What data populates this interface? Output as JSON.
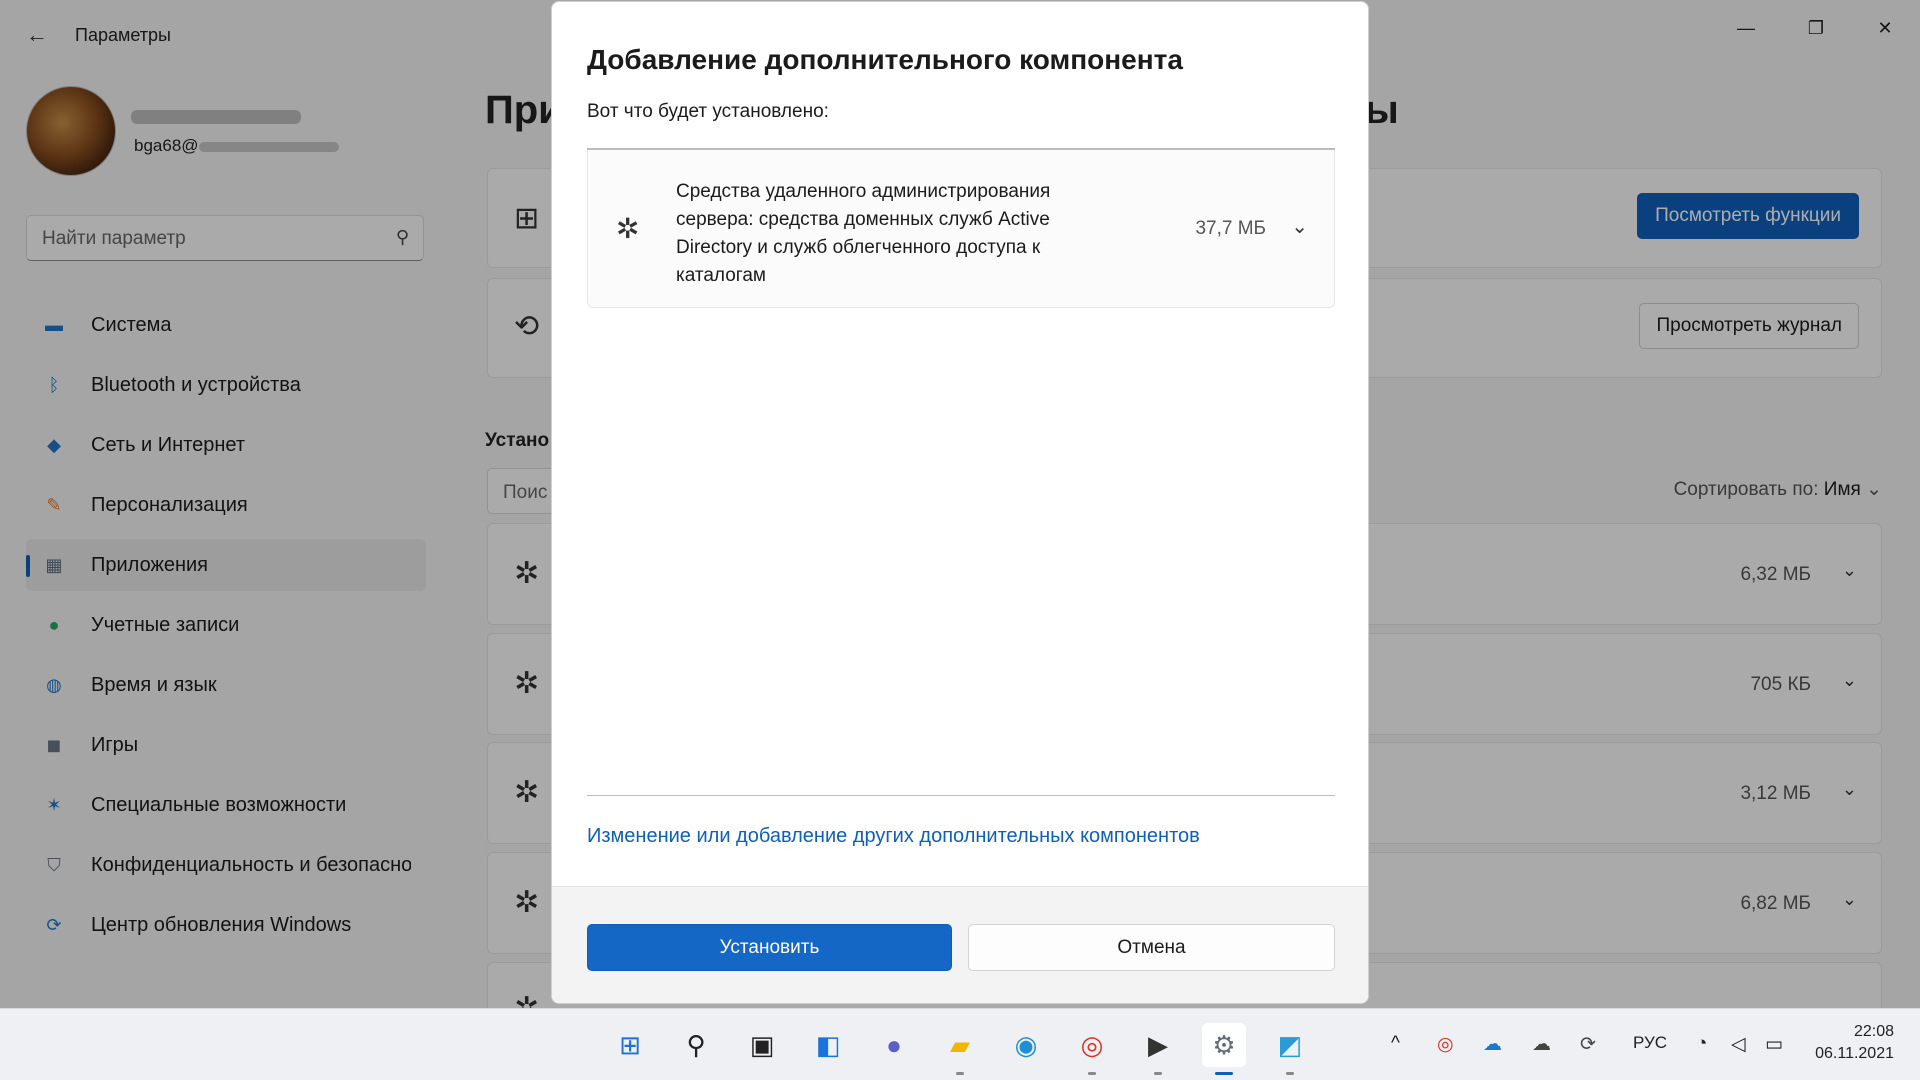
{
  "window": {
    "title": "Параметры",
    "back_icon": "←",
    "controls": {
      "minimize": "—",
      "maximize": "❐",
      "close": "✕"
    }
  },
  "profile": {
    "email_prefix": "bga68@"
  },
  "sidebar": {
    "search_placeholder": "Найти параметр",
    "items": [
      {
        "label": "Система",
        "icon": "system-icon",
        "color": "#1e77c8"
      },
      {
        "label": "Bluetooth и устройства",
        "icon": "bluetooth-icon",
        "color": "#1e77c8"
      },
      {
        "label": "Сеть и Интернет",
        "icon": "wifi-icon",
        "color": "#1e77c8"
      },
      {
        "label": "Персонализация",
        "icon": "brush-icon",
        "color": "#e07a2c"
      },
      {
        "label": "Приложения",
        "icon": "apps-icon",
        "color": "#5a6b7d",
        "active": true
      },
      {
        "label": "Учетные записи",
        "icon": "accounts-icon",
        "color": "#2aa56c"
      },
      {
        "label": "Время и язык",
        "icon": "time-language-icon",
        "color": "#1e77c8"
      },
      {
        "label": "Игры",
        "icon": "gamepad-icon",
        "color": "#6b7785"
      },
      {
        "label": "Специальные возможности",
        "icon": "accessibility-icon",
        "color": "#1e77c8"
      },
      {
        "label": "Конфиденциальность и безопасность",
        "icon": "shield-icon",
        "color": "#6b7785"
      },
      {
        "label": "Центр обновления Windows",
        "icon": "update-icon",
        "color": "#1e77c8"
      }
    ]
  },
  "main": {
    "title_start": "При",
    "title_end": "ты",
    "view_features_button": "Посмотреть функции",
    "view_history_button": "Просмотреть журнал",
    "installed_label": "Устано",
    "installed_search_placeholder": "Поис",
    "sort_label": "Сортировать по:",
    "sort_value": "Имя",
    "rows": [
      {
        "size": "6,32 МБ"
      },
      {
        "size": "705 КБ"
      },
      {
        "size": "3,12 МБ"
      },
      {
        "size": "6,82 МБ"
      }
    ]
  },
  "dialog": {
    "title": "Добавление дополнительного компонента",
    "subtitle": "Вот что будет установлено:",
    "component": {
      "name": "Средства удаленного администрирования сервера: средства доменных служб Active Directory и служб облегченного доступа к каталогам",
      "size": "37,7 МБ"
    },
    "link": "Изменение или добавление других дополнительных компонентов",
    "install_button": "Установить",
    "cancel_button": "Отмена"
  },
  "taskbar": {
    "apps": [
      {
        "name": "start-icon",
        "glyph": "⊞",
        "color": "#1a73d9"
      },
      {
        "name": "search-icon",
        "glyph": "⚲",
        "color": "#222222"
      },
      {
        "name": "task-view-icon",
        "glyph": "▣",
        "color": "#222222"
      },
      {
        "name": "widgets-icon",
        "glyph": "◧",
        "color": "#1a73d9"
      },
      {
        "name": "chat-icon",
        "glyph": "●",
        "color": "#5b5fc7"
      },
      {
        "name": "file-explorer-icon",
        "glyph": "▰",
        "color": "#f2b600"
      },
      {
        "name": "edge-icon",
        "glyph": "◉",
        "color": "#1e8fd6"
      },
      {
        "name": "chrome-icon",
        "glyph": "◎",
        "color": "#d93025"
      },
      {
        "name": "terminal-icon",
        "glyph": "▶",
        "color": "#333333"
      },
      {
        "name": "settings-icon",
        "glyph": "⚙",
        "color": "#5f6b78",
        "active": true
      },
      {
        "name": "control-panel-icon",
        "glyph": "◩",
        "color": "#2a9bd6"
      }
    ],
    "tray": {
      "chevron": "^",
      "language": "РУС",
      "time": "22:08",
      "date": "06.11.2021"
    }
  },
  "colors": {
    "accent": "#0f5fb8",
    "install_button": "#1467c4"
  }
}
